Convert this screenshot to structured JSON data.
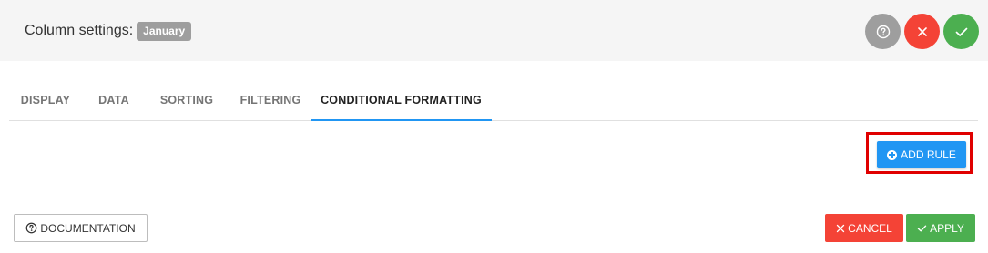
{
  "header": {
    "title": "Column settings:",
    "column_name": "January",
    "buttons": [
      {
        "icon": "question-circle-icon",
        "color": "#9e9e9e"
      },
      {
        "icon": "close-icon",
        "color": "#f44336"
      },
      {
        "icon": "check-icon",
        "color": "#4caf50"
      }
    ]
  },
  "tabs": [
    {
      "label": "DISPLAY",
      "active": false
    },
    {
      "label": "DATA",
      "active": false
    },
    {
      "label": "SORTING",
      "active": false
    },
    {
      "label": "FILTERING",
      "active": false
    },
    {
      "label": "CONDITIONAL FORMATTING",
      "active": true
    }
  ],
  "content": {
    "add_rule_label": "ADD RULE",
    "add_rule_icon": "plus-circle-icon",
    "highlight_color": "#e00000"
  },
  "footer": {
    "documentation_label": "DOCUMENTATION",
    "cancel_label": "CANCEL",
    "apply_label": "APPLY"
  },
  "colors": {
    "accent": "#2196f3",
    "danger": "#f44336",
    "success": "#4caf50",
    "neutral": "#9e9e9e"
  }
}
